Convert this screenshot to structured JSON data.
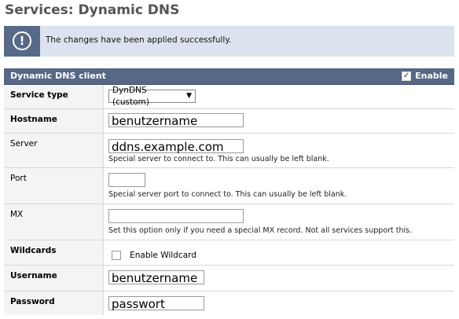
{
  "page": {
    "title": "Services: Dynamic DNS"
  },
  "alert": {
    "icon": "info-circle",
    "message": "The changes have been applied successfully."
  },
  "panel": {
    "title": "Dynamic DNS client",
    "enable_label": "Enable",
    "enable_checked": true
  },
  "fields": {
    "service_type": {
      "label": "Service type",
      "value": "DynDNS (custom)"
    },
    "hostname": {
      "label": "Hostname",
      "value": "benutzername"
    },
    "server": {
      "label": "Server",
      "value": "ddns.example.com",
      "hint": "Special server to connect to. This can usually be left blank."
    },
    "port": {
      "label": "Port",
      "value": "",
      "hint": "Special server port to connect to. This can usually be left blank."
    },
    "mx": {
      "label": "MX",
      "value": "",
      "hint": "Set this option only if you need a special MX record. Not all services support this."
    },
    "wildcards": {
      "label": "Wildcards",
      "checkbox_label": "Enable Wildcard",
      "checked": false
    },
    "username": {
      "label": "Username",
      "value": "benutzername"
    },
    "password": {
      "label": "Password",
      "value": "passwort"
    }
  }
}
